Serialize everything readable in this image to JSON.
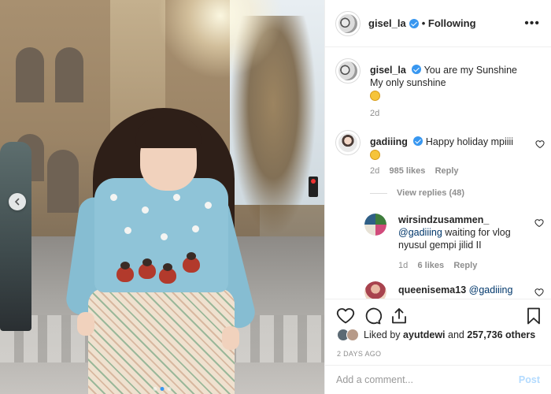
{
  "post": {
    "username": "gisel_la",
    "follow_label": "Following",
    "more_label": "•••"
  },
  "caption": {
    "username": "gisel_la",
    "line1": "You are my Sunshine",
    "line2": "My only sunshine",
    "emoji": "sun-emoji",
    "time": "2d"
  },
  "comments": [
    {
      "username": "gadiiing",
      "text": "Happy holiday mpiiii",
      "emoji": "smile-emoji",
      "time": "2d",
      "likes": "985 likes",
      "reply_label": "Reply",
      "view_replies": "View replies (48)"
    },
    {
      "username": "wirsindzusammen_",
      "mention": "@gadiiing",
      "text": "waiting for vlog nyusul gempi jilid II",
      "time": "1d",
      "likes": "6 likes",
      "reply_label": "Reply"
    },
    {
      "username": "queenisema13",
      "mention": "@gadiiing"
    }
  ],
  "likes": {
    "prefix": "Liked by",
    "user": "ayutdewi",
    "middle": "and",
    "count": "257,736 others"
  },
  "date": "2 DAYS AGO",
  "comment_box": {
    "placeholder": "Add a comment...",
    "post_label": "Post"
  },
  "carousel": {
    "slides": 3,
    "active": 1
  },
  "colors": {
    "accent": "#3897f0",
    "text": "#262626",
    "muted": "#8e8e8e",
    "border": "#efefef"
  },
  "icons": [
    "verified-badge-icon",
    "heart-icon",
    "comment-icon",
    "share-icon",
    "bookmark-icon",
    "chevron-left-icon"
  ]
}
